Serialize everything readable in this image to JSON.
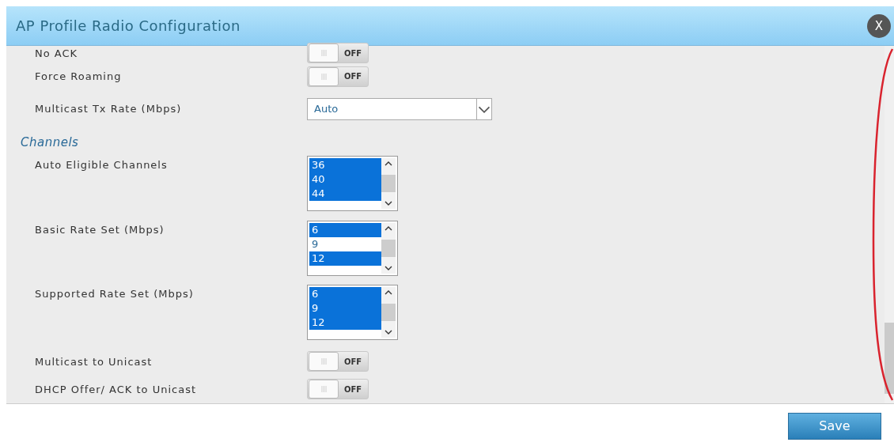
{
  "dialog": {
    "title": "AP Profile Radio Configuration",
    "close_label": "X"
  },
  "sections": [
    {
      "fields": [
        {
          "kind": "toggle",
          "label": "No ACK",
          "on": false,
          "state_text": "OFF"
        },
        {
          "kind": "toggle",
          "label": "Force Roaming",
          "on": false,
          "state_text": "OFF"
        },
        {
          "kind": "select",
          "label": "Multicast Tx Rate (Mbps)",
          "value": "Auto"
        }
      ]
    },
    {
      "heading": "Channels",
      "fields": [
        {
          "kind": "listbox",
          "label": "Auto Eligible Channels",
          "options": [
            {
              "label": "36",
              "selected": true
            },
            {
              "label": "40",
              "selected": true
            },
            {
              "label": "44",
              "selected": true
            }
          ]
        },
        {
          "kind": "listbox",
          "label": "Basic Rate Set (Mbps)",
          "options": [
            {
              "label": "6",
              "selected": true
            },
            {
              "label": "9",
              "selected": false
            },
            {
              "label": "12",
              "selected": true
            }
          ]
        },
        {
          "kind": "listbox",
          "label": "Supported Rate Set (Mbps)",
          "options": [
            {
              "label": "6",
              "selected": true
            },
            {
              "label": "9",
              "selected": true
            },
            {
              "label": "12",
              "selected": true
            }
          ]
        },
        {
          "kind": "toggle",
          "label": "Multicast to Unicast",
          "on": false,
          "state_text": "OFF"
        },
        {
          "kind": "toggle",
          "label": "DHCP Offer/ ACK to Unicast",
          "on": false,
          "state_text": "OFF"
        }
      ]
    }
  ],
  "footer": {
    "save_label": "Save"
  }
}
